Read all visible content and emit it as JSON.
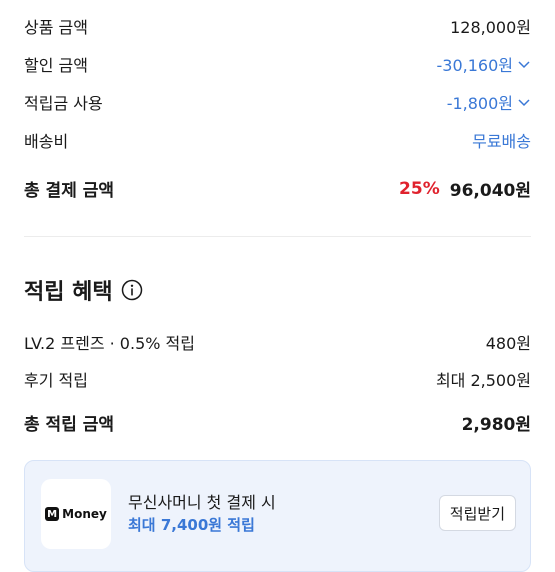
{
  "payment": {
    "product_label": "상품 금액",
    "product_value": "128,000원",
    "discount_label": "할인 금액",
    "discount_value": "-30,160원",
    "points_label": "적립금 사용",
    "points_value": "-1,800원",
    "shipping_label": "배송비",
    "shipping_value": "무료배송",
    "total_label": "총 결제 금액",
    "total_discount_pct": "25%",
    "total_value": "96,040원"
  },
  "rewards": {
    "title": "적립 혜택",
    "level_label": "LV.2 프렌즈 · 0.5% 적립",
    "level_value": "480원",
    "review_label": "후기 적립",
    "review_value": "최대 2,500원",
    "total_label": "총 적립 금액",
    "total_value": "2,980원"
  },
  "banner": {
    "logo_mark": "M",
    "logo_text": "Money",
    "title": "무신사머니 첫 결제 시",
    "subtitle": "최대 7,400원 적립",
    "button": "적립받기"
  },
  "colors": {
    "accent_blue": "#3a78d6",
    "discount_red": "#e0222d",
    "banner_bg": "#eef3fc"
  },
  "icons": [
    "chevron-down-icon",
    "info-icon",
    "money-logo-icon"
  ]
}
